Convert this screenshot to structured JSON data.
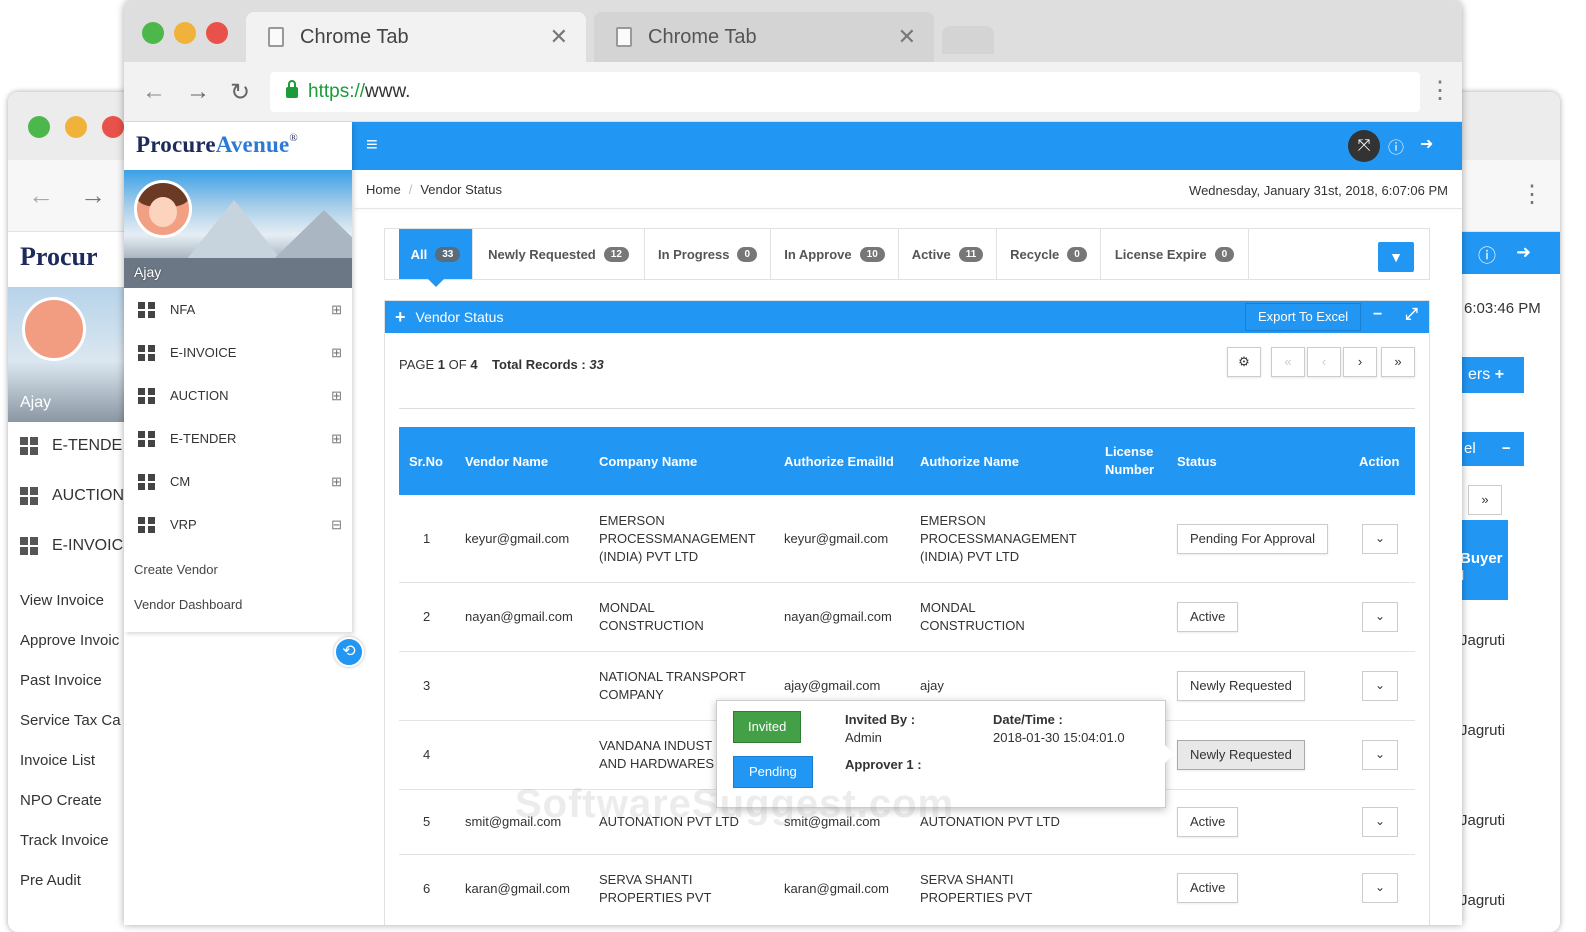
{
  "browser": {
    "tabs": [
      {
        "title": "Chrome Tab"
      },
      {
        "title": "Chrome Tab"
      }
    ],
    "url_scheme": "https://",
    "url_rest": "www."
  },
  "back_window": {
    "brand": "Procur",
    "user": "Ajay",
    "menu": [
      "E-TENDE",
      "AUCTION",
      "E-INVOIC"
    ],
    "links": [
      "View Invoice",
      "Approve Invoic",
      "Past Invoice",
      "Service Tax Ca",
      "Invoice List",
      "NPO Create",
      "Track Invoice",
      "Pre Audit"
    ],
    "right": {
      "time": "6:03:46 PM",
      "btn": "ers",
      "btn2": "el",
      "next": "»",
      "col": "Buyer I",
      "names": [
        "Jagruti",
        "Jagruti",
        "Jagruti",
        "Jagruti"
      ]
    }
  },
  "app": {
    "brand_a": "Procure",
    "brand_b": "Avenue",
    "brand_mark": "®",
    "user": "Ajay",
    "menu": [
      {
        "label": "NFA",
        "state": "⊞"
      },
      {
        "label": "E-INVOICE",
        "state": "⊞"
      },
      {
        "label": "AUCTION",
        "state": "⊞"
      },
      {
        "label": "E-TENDER",
        "state": "⊞"
      },
      {
        "label": "CM",
        "state": "⊞"
      },
      {
        "label": "VRP",
        "state": "⊟"
      }
    ],
    "submenu": [
      "Create Vendor",
      "Vendor Dashboard"
    ],
    "breadcrumb": {
      "home": "Home",
      "sep": "/",
      "current": "Vendor Status"
    },
    "datetime": "Wednesday, January 31st, 2018, 6:07:06 PM",
    "filter_tabs": [
      {
        "label": "All",
        "count": "33"
      },
      {
        "label": "Newly Requested",
        "count": "12"
      },
      {
        "label": "In Progress",
        "count": "0"
      },
      {
        "label": "In Approve",
        "count": "10"
      },
      {
        "label": "Active",
        "count": "11"
      },
      {
        "label": "Recycle",
        "count": "0"
      },
      {
        "label": "License Expire",
        "count": "0"
      }
    ],
    "panel": {
      "title": "Vendor Status",
      "export": "Export To Excel",
      "page_prefix": "PAGE",
      "page_current": "1",
      "page_of": "OF",
      "page_total": "4",
      "records_label": "Total Records :",
      "records_value": "33",
      "pager": [
        "«",
        "‹",
        "›",
        "»"
      ]
    },
    "table": {
      "headers": [
        "Sr.No",
        "Vendor Name",
        "Company Name",
        "Authorize EmailId",
        "Authorize Name",
        "License Number",
        "Status",
        "Action"
      ],
      "rows": [
        {
          "sr": "1",
          "vendor": "keyur@gmail.com",
          "company": "EMERSON PROCESSMANAGEMENT (INDIA) PVT LTD",
          "email": "keyur@gmail.com",
          "name": "EMERSON PROCESSMANAGEMENT (INDIA) PVT LTD",
          "status": "Pending For Approval"
        },
        {
          "sr": "2",
          "vendor": "nayan@gmail.com",
          "company": "MONDAL CONSTRUCTION",
          "email": "nayan@gmail.com",
          "name": "MONDAL CONSTRUCTION",
          "status": "Active"
        },
        {
          "sr": "3",
          "vendor": "",
          "company": "NATIONAL TRANSPORT COMPANY",
          "email": "ajay@gmail.com",
          "name": "ajay",
          "status": "Newly Requested"
        },
        {
          "sr": "4",
          "vendor": "",
          "company": "VANDANA INDUST AND HARDWARES",
          "email": "",
          "name": "",
          "status": "Newly Requested"
        },
        {
          "sr": "5",
          "vendor": "smit@gmail.com",
          "company": "AUTONATION PVT LTD",
          "email": "smit@gmail.com",
          "name": "AUTONATION PVT LTD",
          "status": "Active"
        },
        {
          "sr": "6",
          "vendor": "karan@gmail.com",
          "company": "SERVA SHANTI PROPERTIES PVT",
          "email": "karan@gmail.com",
          "name": "SERVA SHANTI PROPERTIES PVT",
          "status": "Active"
        }
      ]
    },
    "popover": {
      "invited": "Invited",
      "pending": "Pending",
      "invited_by_label": "Invited By :",
      "invited_by_value": "Admin",
      "datetime_label": "Date/Time :",
      "datetime_value": "2018-01-30 15:04:01.0",
      "approver_label": "Approver 1 :"
    },
    "watermark": "SoftwareSuggest.com"
  },
  "colors": {
    "primary": "#2196f3",
    "invited": "#43a047",
    "pending": "#2196f3"
  }
}
